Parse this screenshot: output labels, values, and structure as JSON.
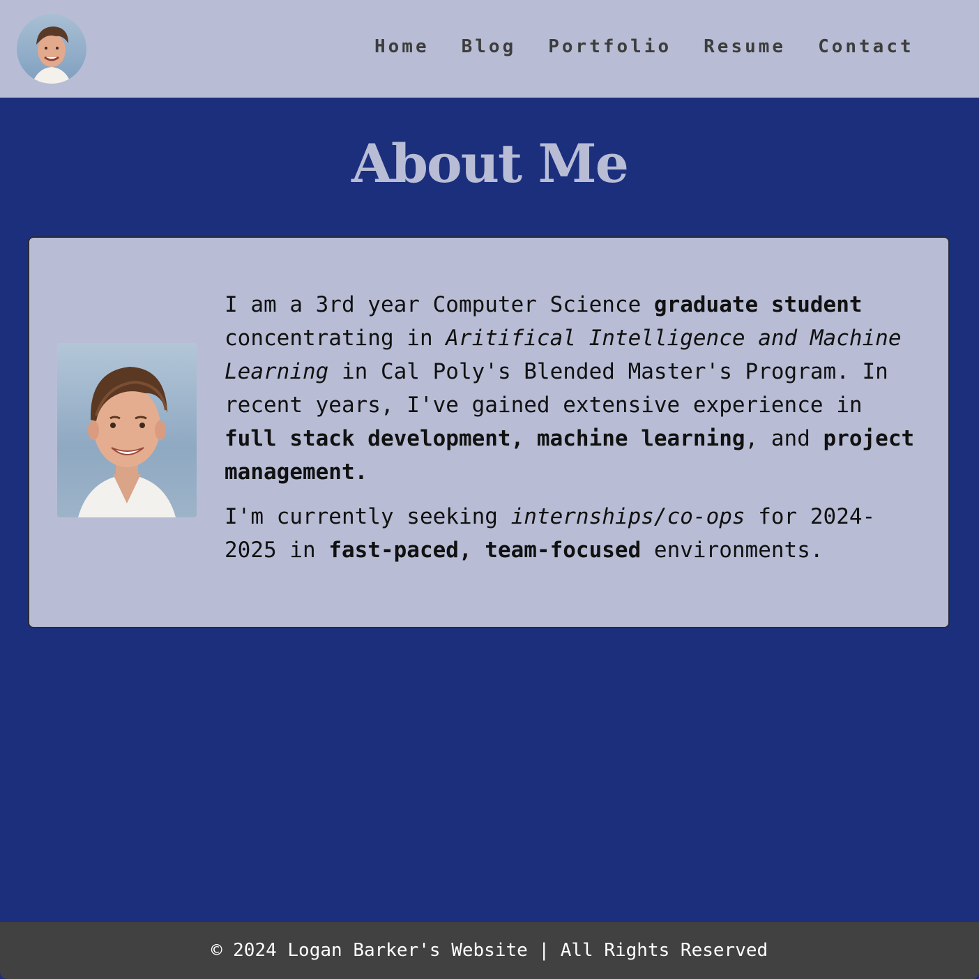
{
  "nav": {
    "links": [
      "Home",
      "Blog",
      "Portfolio",
      "Resume",
      "Contact"
    ]
  },
  "main": {
    "title": "About Me",
    "paragraph1": {
      "p1": "I am a 3rd year Computer Science ",
      "b1": "graduate student",
      "p2": " concentrating in ",
      "i1": "Aritifical Intelligence and Machine Learning",
      "p3": " in Cal Poly's Blended Master's Program. In recent years, I've gained extensive experience in ",
      "b2": "full stack development, machine learning",
      "p4": ", and ",
      "b3": "project management."
    },
    "paragraph2": {
      "p1": "I'm currently seeking ",
      "i1": "internships/co-ops",
      "p2": " for 2024-2025 in ",
      "b1": "fast-paced, team-focused",
      "p3": " environments."
    }
  },
  "footer": {
    "text": "© 2024 Logan Barker's Website | All Rights Reserved"
  },
  "colors": {
    "background": "#1b2f7d",
    "nav_bg": "#b8bdd5",
    "card_bg": "#b8bdd5",
    "footer_bg": "#404140",
    "title": "#b8bdd5"
  }
}
